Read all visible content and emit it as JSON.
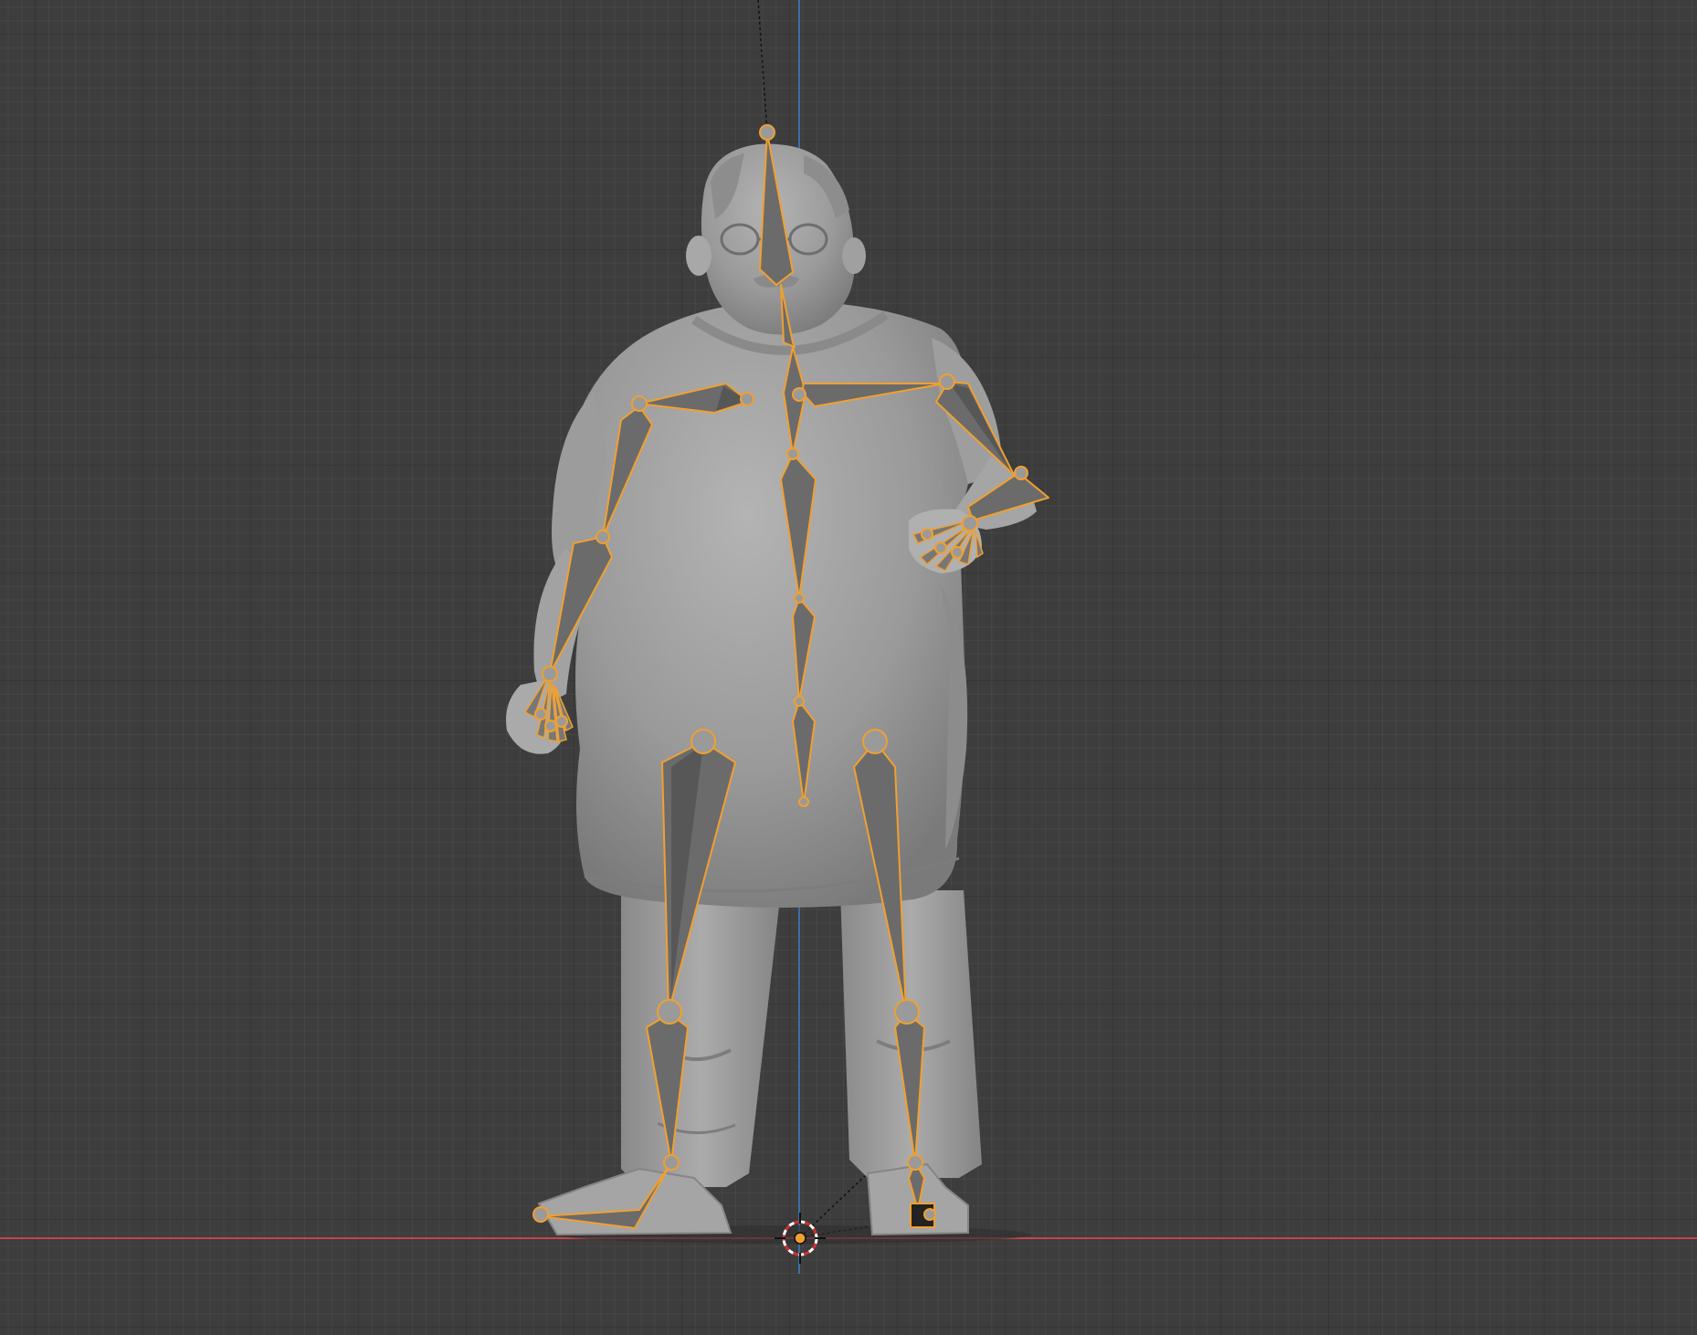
{
  "viewport": {
    "name": "3D Viewport",
    "colors": {
      "background": "#3d3d3d",
      "x_axis": "#c6424e",
      "z_axis": "#3a6ea5",
      "bone_outline": "#f0a030",
      "mesh": "#9c9c9c"
    }
  },
  "scene": {
    "character_mesh": "cartoon-man-with-glasses",
    "armature": "selected-armature-bones",
    "origin": "3d-cursor"
  }
}
